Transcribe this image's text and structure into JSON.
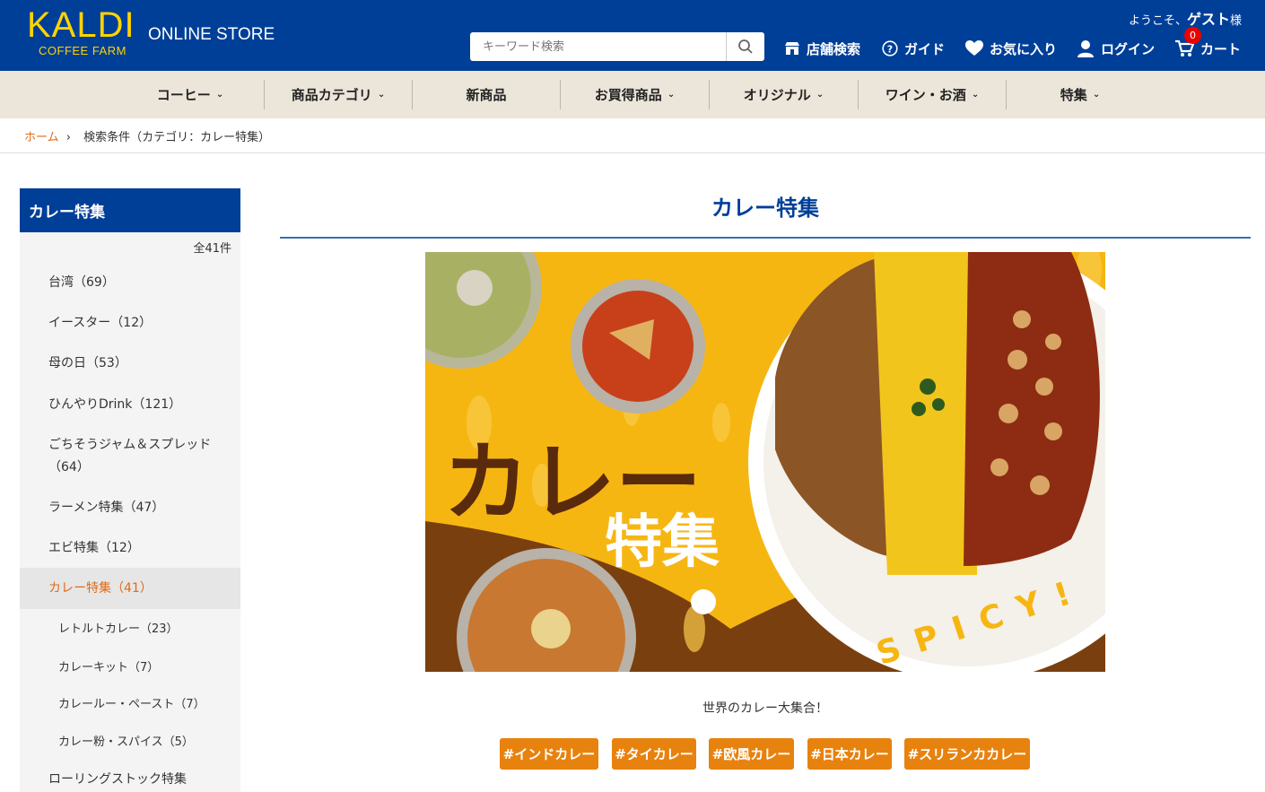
{
  "header": {
    "logo_main": "KALDI",
    "logo_sub": "COFFEE FARM",
    "store_label": "ONLINE STORE",
    "welcome_prefix": "ようこそ、",
    "welcome_user": "ゲスト",
    "welcome_suffix": "様",
    "search_placeholder": "キーワード検索",
    "nav": {
      "store_search": "店舗検索",
      "guide": "ガイド",
      "favorites": "お気に入り",
      "login": "ログイン",
      "cart": "カート",
      "cart_count": "0"
    }
  },
  "categories": [
    "コーヒー",
    "商品カテゴリ",
    "新商品",
    "お買得商品",
    "オリジナル",
    "ワイン・お酒",
    "特集"
  ],
  "breadcrumb": {
    "home": "ホーム",
    "current": "検索条件（カテゴリ：カレー特集）"
  },
  "sidebar": {
    "title": "カレー特集",
    "count": "全41件",
    "items": [
      "台湾（69）",
      "イースター（12）",
      "母の日（53）",
      "ひんやりDrink（121）",
      "ごちそうジャム＆スプレッド（64）",
      "ラーメン特集（47）",
      "エビ特集（12）",
      "カレー特集（41）",
      "レトルトカレー（23）",
      "カレーキット（7）",
      "カレールー・ペースト（7）",
      "カレー粉・スパイス（5）",
      "ローリングストック特集"
    ]
  },
  "main": {
    "title": "カレー特集",
    "banner": {
      "title_1": "カレー",
      "title_2": "特集",
      "spicy": "SPICY!"
    },
    "tagline": "世界のカレー大集合！",
    "tags": [
      "#インドカレー",
      "#タイカレー",
      "#欧風カレー",
      "#日本カレー",
      "#スリランカカレー"
    ]
  },
  "colors": {
    "brand_blue": "#003f98",
    "logo_yellow": "#ffd300",
    "accent_orange": "#e06a18",
    "tag_orange": "#e8820e",
    "category_bar": "#ece5da"
  }
}
